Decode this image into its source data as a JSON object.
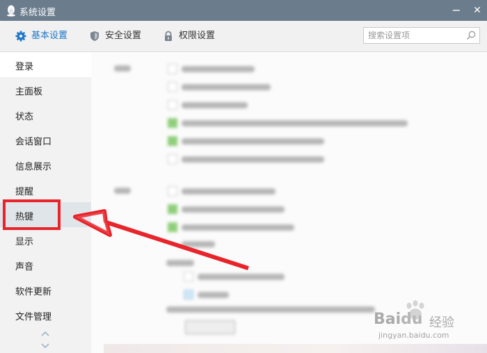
{
  "window": {
    "title": "系统设置",
    "minimize": "−",
    "close": "✕"
  },
  "toolbar": {
    "tabs": [
      {
        "label": "基本设置",
        "icon": "gear-icon",
        "active": true
      },
      {
        "label": "安全设置",
        "icon": "shield-icon",
        "active": false
      },
      {
        "label": "权限设置",
        "icon": "lock-icon",
        "active": false
      }
    ],
    "search": {
      "placeholder": "搜索设置项",
      "value": ""
    }
  },
  "sidebar": {
    "items": [
      {
        "label": "登录"
      },
      {
        "label": "主面板"
      },
      {
        "label": "状态"
      },
      {
        "label": "会话窗口"
      },
      {
        "label": "信息展示"
      },
      {
        "label": "提醒"
      },
      {
        "label": "热键"
      },
      {
        "label": "显示"
      },
      {
        "label": "声音"
      },
      {
        "label": "软件更新"
      },
      {
        "label": "文件管理"
      }
    ],
    "selected": "登录",
    "highlighted": "热键"
  },
  "colors": {
    "titlebar": "#6b7c8c",
    "accent": "#1f78c8",
    "annotation": "#e8232a"
  },
  "watermark": {
    "logo": "Bai",
    "logo_paw": "du",
    "label": "经验",
    "url": "jingyan.baidu.com"
  }
}
